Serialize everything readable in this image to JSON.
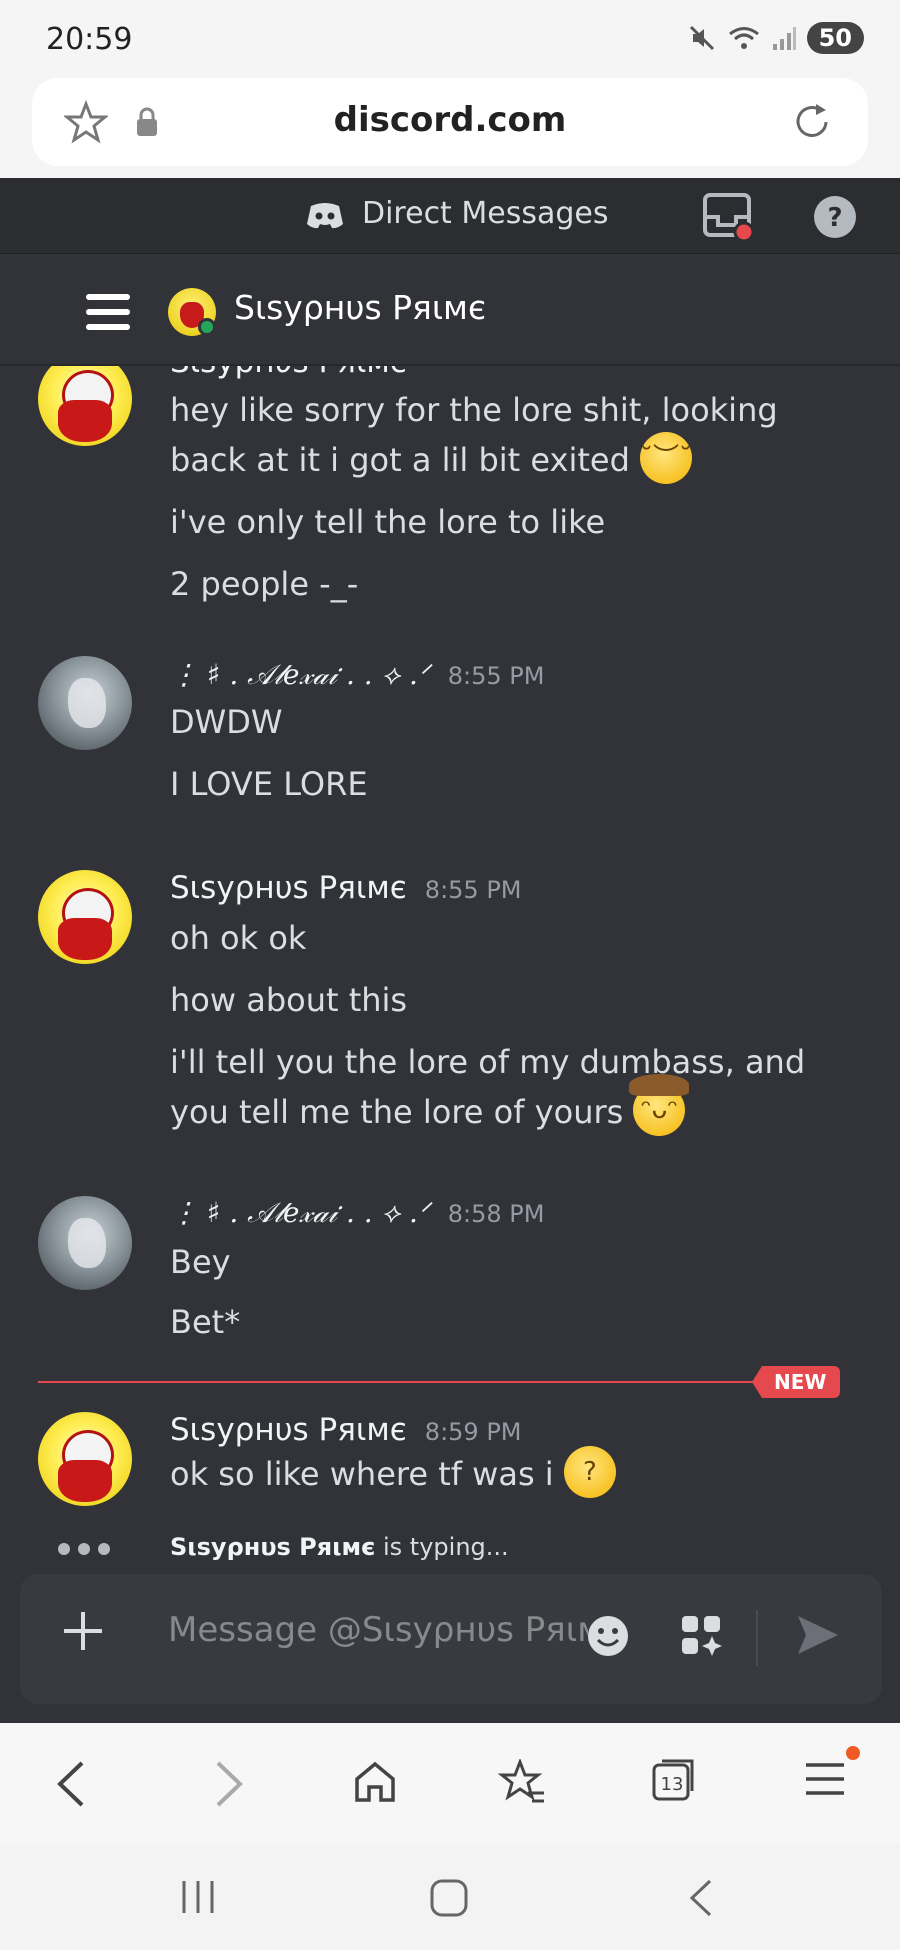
{
  "status_bar": {
    "time": "20:59",
    "battery": "50"
  },
  "browser": {
    "url": "discord.com",
    "tab_count": "13"
  },
  "header": {
    "title": "Direct Messages"
  },
  "channel": {
    "name": "Sιsyρнυs Pяιмє"
  },
  "messages": [
    {
      "author": "Sιsyρнυs Pяιмє",
      "lines": [
        "hey like sorry for the lore shit, looking",
        "back at it i got a lil bit exited",
        "i've only tell the lore to like",
        "2 people -_-"
      ]
    },
    {
      "author": "⋮ ♯ . 𝒜𝓁𝑒𝓍𝒶𝒾 . . ⟡ .ᐟ",
      "time": "8:55 PM",
      "lines": [
        "DWDW",
        "I LOVE LORE"
      ]
    },
    {
      "author": "Sιsyρнυs Pяιмє",
      "time": "8:55 PM",
      "lines": [
        "oh ok ok",
        "how about this",
        "i'll tell you the lore of my dumbass, and",
        "you tell me the lore of yours"
      ]
    },
    {
      "author": "⋮ ♯ . 𝒜𝓁𝑒𝓍𝒶𝒾 . . ⟡ .ᐟ",
      "time": "8:58 PM",
      "lines": [
        "Bey",
        "Bet*"
      ]
    },
    {
      "author": "Sιsyρнυs Pяιмє",
      "time": "8:59 PM",
      "lines": [
        "ok so like where tf was i"
      ]
    }
  ],
  "divider": {
    "badge": "NEW"
  },
  "typing": {
    "user": "Sιsyρнυs Pяιмє",
    "suffix": " is typing..."
  },
  "composer": {
    "placeholder": "Message @Sιsyρнυs Pяιм"
  },
  "colors": {
    "accent_new": "#e5484d",
    "online": "#23a55a",
    "bg_chat": "#313338"
  }
}
